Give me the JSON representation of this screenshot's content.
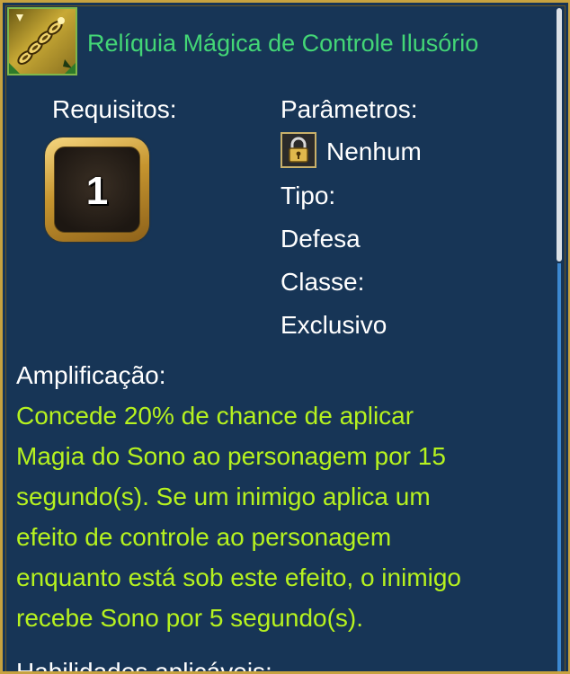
{
  "item": {
    "title": "Relíquia Mágica de Controle Ilusório",
    "icon": "chain-relic-icon"
  },
  "requirements": {
    "label": "Requisitos:",
    "level": "1"
  },
  "parameters": {
    "label": "Parâmetros:",
    "lock_icon": "lock-icon",
    "value": "Nenhum"
  },
  "type": {
    "label": "Tipo:",
    "value": "Defesa"
  },
  "class": {
    "label": "Classe:",
    "value": "Exclusivo"
  },
  "amplification": {
    "label": "Amplificação:",
    "text": "Concede 20% de chance de aplicar\nMagia do Sono ao personagem por 15\nsegundo(s). Se um inimigo aplica um\nefeito de controle ao personagem\nenquanto está sob este efeito, o inimigo\nrecebe Sono por 5 segundo(s)."
  },
  "next_heading": "Habilidades aplicáveis:",
  "colors": {
    "title": "#43d676",
    "effect_text": "#b6f21f",
    "panel_bg": "#173556",
    "border_gold": "#c7a23f",
    "scrollbar": "#3c88d0"
  }
}
